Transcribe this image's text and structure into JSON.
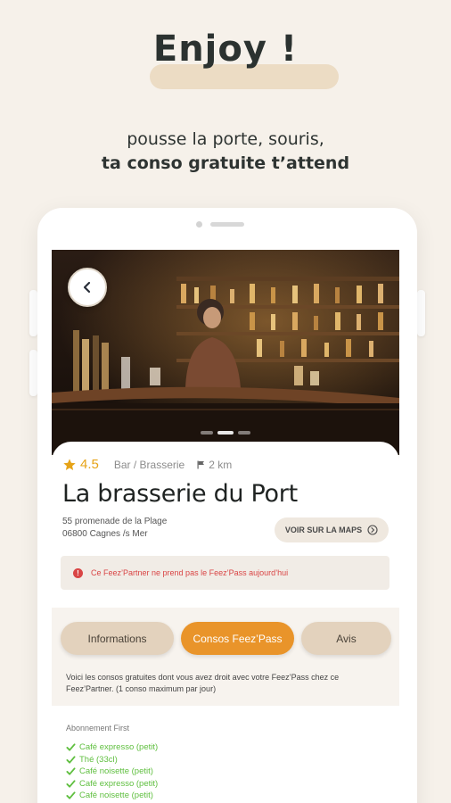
{
  "hero": {
    "title": "Enjoy !",
    "subtitle_line1": "pousse la porte, souris,",
    "subtitle_line2": "ta conso gratuite t’attend"
  },
  "venue": {
    "rating": "4.5",
    "category": "Bar / Brasserie",
    "distance": "2 km",
    "name": "La brasserie du Port",
    "address_line1": "55 promenade de la Plage",
    "address_line2": "06800 Cagnes /s Mer",
    "maps_button": "VOIR SUR LA MAPS"
  },
  "alert": {
    "icon": "!",
    "text": "Ce Feez’Partner ne prend pas le Feez’Pass aujourd’hui"
  },
  "tabs": [
    {
      "label": "Informations",
      "active": false
    },
    {
      "label": "Consos Feez’Pass",
      "active": true
    },
    {
      "label": "Avis",
      "active": false
    }
  ],
  "consos_info": "Voici les consos gratuites dont vous avez droit avec votre Feez’Pass chez ce Feez’Partner. (1 conso maximum par jour)",
  "subscription": {
    "title": "Abonnement First",
    "items": [
      "Café expresso (petit)",
      "Thé (33cl)",
      "Café noisette (petit)",
      "Café expresso (petit)",
      "Café noisette (petit)"
    ]
  },
  "colors": {
    "background": "#f6f1ea",
    "accent_orange": "#e9942a",
    "tab_inactive": "#e3d2bd",
    "alert_red": "#d94545",
    "check_green": "#5fbf3f",
    "star_gold": "#e6a317"
  },
  "icons": {
    "back": "chevron-left-icon",
    "rating": "star-icon",
    "distance": "flag-icon",
    "maps": "arrow-circle-right-icon",
    "alert": "exclamation-circle-icon",
    "offer": "check-icon"
  }
}
